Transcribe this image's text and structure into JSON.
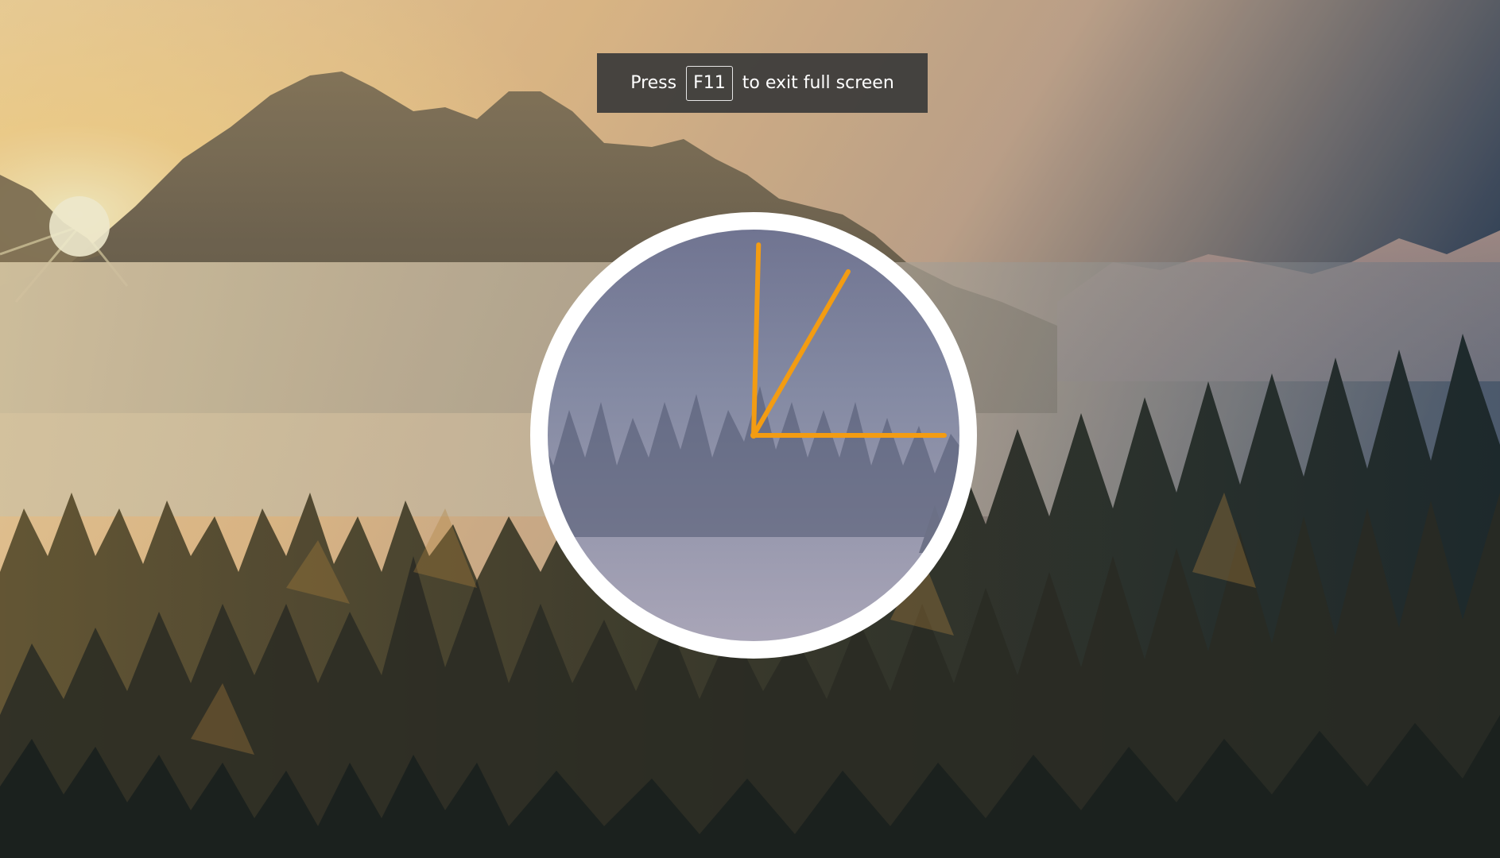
{
  "wallpaper": {
    "description_icon": "mountain-forest-landscape",
    "colors": {
      "sky_warm": "#f3c98b",
      "sky_cool": "#33475f",
      "mist": "#d9c7a6",
      "trees_dark": "#1f2a2a",
      "sun": "#fff3c2"
    }
  },
  "fullscreen_hint": {
    "prefix": "Press",
    "key": "F11",
    "suffix": "to exit full screen"
  },
  "clock": {
    "hand_color": "#f39c12",
    "ring_color": "#ffffff",
    "hours": 1,
    "minutes": 0,
    "seconds": 15
  }
}
